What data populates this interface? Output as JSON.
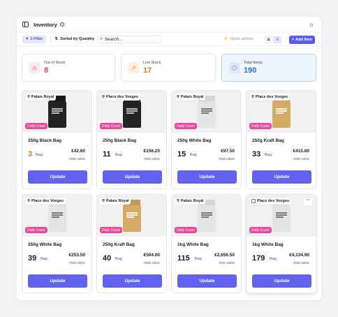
{
  "header": {
    "title": "Inventory",
    "info_glyph": "i"
  },
  "toolbar": {
    "filter_label": "1 Filter",
    "sort_label": "Sorted by Quantity",
    "search_placeholder": "Search...",
    "quick_actions": "Quick actions",
    "add_label": "Add Item"
  },
  "stats": [
    {
      "label": "Out of Stock",
      "value": "8",
      "icon": "alert-triangle-icon",
      "color": "#e5484d",
      "icon_bg": "#fde8e8"
    },
    {
      "label": "Low Stock",
      "value": "17",
      "icon": "trend-up-icon",
      "color": "#e07a12",
      "icon_bg": "#fdeee0"
    },
    {
      "label": "Total Items",
      "value": "190",
      "icon": "cube-icon",
      "color": "#2f6fd6",
      "icon_bg": "#dde9fb"
    }
  ],
  "badge_label": "Daily Count",
  "unit_label": "Bag",
  "total_value_label": "total value",
  "update_label": "Update",
  "items": [
    {
      "location": "Palais Royal",
      "name": "250g Black Bag",
      "qty": "3",
      "price": "€42.60",
      "bag": "black",
      "low": true
    },
    {
      "location": "Place des Vosges",
      "name": "250g Black Bag",
      "qty": "11",
      "price": "€156.20",
      "bag": "black",
      "low": false
    },
    {
      "location": "Palais Royal",
      "name": "250g White Bag",
      "qty": "15",
      "price": "€97.50",
      "bag": "white",
      "low": false
    },
    {
      "location": "Place des Vosges",
      "name": "250g Kraft Bag",
      "qty": "33",
      "price": "€415.80",
      "bag": "kraft",
      "low": false
    },
    {
      "location": "Place des Vosges",
      "name": "250g White Bag",
      "qty": "39",
      "price": "€253.50",
      "bag": "white",
      "low": false
    },
    {
      "location": "Palais Royal",
      "name": "250g Kraft Bag",
      "qty": "40",
      "price": "€504.00",
      "bag": "kraft",
      "low": false
    },
    {
      "location": "Palais Royal",
      "name": "1kg White Bag",
      "qty": "115",
      "price": "€2,656.50",
      "bag": "white",
      "low": false
    },
    {
      "location": "Place des Vosges",
      "name": "1kg White Bag",
      "qty": "179",
      "price": "€4,134.90",
      "bag": "white",
      "low": false,
      "selected_ui": true,
      "more_glyph": "···"
    }
  ],
  "colors": {
    "accent": "#5b5bf0",
    "badge": "#ec4899",
    "low_stock_qty": "#e07a12"
  }
}
